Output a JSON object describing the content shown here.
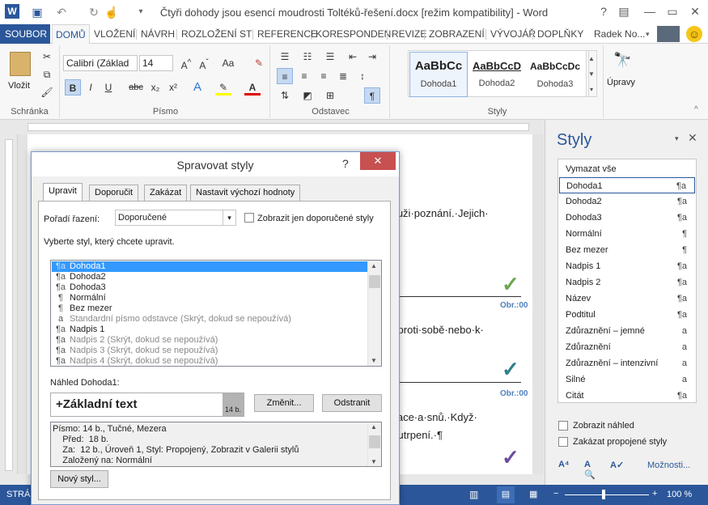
{
  "window": {
    "title": "Čtyři dohody jsou esencí moudrosti Toltéků-řešení.docx [režim kompatibility] - Word",
    "help": "?",
    "minimize": "—",
    "restore": "▭",
    "close": "✕"
  },
  "quick_access": {
    "word_icon": "W",
    "save": "💾",
    "undo": "↶",
    "redo": "↻",
    "touch": "☝",
    "more": "▾"
  },
  "tabs": {
    "file": "SOUBOR",
    "items": [
      "DOMŮ",
      "VLOŽENÍ",
      "NÁVRH",
      "ROZLOŽENÍ ST",
      "REFERENCE",
      "KORESPONDEN",
      "REVIZE",
      "ZOBRAZENÍ",
      "VÝVOJÁŘ",
      "DOPLŇKY"
    ],
    "user": "Radek No...",
    "smiley": "☺"
  },
  "ribbon": {
    "clipboard": {
      "paste": "Vložit",
      "label": "Schránka"
    },
    "font": {
      "name": "Calibri (Základ",
      "size": "14",
      "bold": "B",
      "italic": "I",
      "underline": "U",
      "strike": "abc",
      "sub": "x₂",
      "sup": "x²",
      "grow": "A^",
      "shrink": "Aˇ",
      "case": "Aa",
      "label": "Písmo"
    },
    "paragraph": {
      "label": "Odstavec",
      "pilcrow": "¶"
    },
    "styles": {
      "label": "Styly",
      "items": [
        {
          "preview": "AaBbCc",
          "name": "Dohoda1"
        },
        {
          "preview": "AaBbCcD",
          "name": "Dohoda2"
        },
        {
          "preview": "AaBbCcDc",
          "name": "Dohoda3"
        }
      ]
    },
    "editing": {
      "label": "Úpravy"
    }
  },
  "document": {
    "lines": [
      "muži·poznání.·Jejich·",
      "a·proti·sobě·nebo·k·",
      "tuace·a·snů.·Když·",
      "o·utrpení.·¶"
    ],
    "captions": [
      "Obr.:00",
      "Obr.:00"
    ],
    "checkmark": "✓"
  },
  "status": {
    "page": "STRÁN",
    "zoom": "100 %",
    "minus": "−",
    "plus": "+"
  },
  "styles_pane": {
    "title": "Styly",
    "clear": "Vymazat vše",
    "items": [
      {
        "name": "Dohoda1",
        "sym": "¶a",
        "selected": true
      },
      {
        "name": "Dohoda2",
        "sym": "¶a"
      },
      {
        "name": "Dohoda3",
        "sym": "¶a"
      },
      {
        "name": "Normální",
        "sym": "¶"
      },
      {
        "name": "Bez mezer",
        "sym": "¶"
      },
      {
        "name": "Nadpis 1",
        "sym": "¶a"
      },
      {
        "name": "Nadpis 2",
        "sym": "¶a"
      },
      {
        "name": "Název",
        "sym": "¶a"
      },
      {
        "name": "Podtitul",
        "sym": "¶a"
      },
      {
        "name": "Zdůraznění – jemné",
        "sym": "a"
      },
      {
        "name": "Zdůraznění",
        "sym": "a"
      },
      {
        "name": "Zdůraznění – intenzivní",
        "sym": "a"
      },
      {
        "name": "Silné",
        "sym": "a"
      },
      {
        "name": "Citát",
        "sym": "¶a"
      }
    ],
    "show_preview": "Zobrazit náhled",
    "disable_linked": "Zakázat propojené styly",
    "options": "Možnosti..."
  },
  "dialog": {
    "title": "Spravovat styly",
    "help": "?",
    "close": "✕",
    "tabs": [
      "Upravit",
      "Doporučit",
      "Zakázat",
      "Nastavit výchozí hodnoty"
    ],
    "sort_label": "Pořadí řazení:",
    "sort_value": "Doporučené",
    "only_recommended": "Zobrazit jen doporučené styly",
    "select_label": "Vyberte styl, který chcete upravit.",
    "list": [
      {
        "sym": "¶a",
        "name": "Dohoda1",
        "state": "sel"
      },
      {
        "sym": "¶a",
        "name": "Dohoda2"
      },
      {
        "sym": "¶a",
        "name": "Dohoda3"
      },
      {
        "sym": "¶",
        "name": "Normální"
      },
      {
        "sym": "¶",
        "name": "Bez mezer"
      },
      {
        "sym": "a",
        "name": "Standardní písmo odstavce  (Skrýt, dokud se nepoužívá)",
        "state": "dis"
      },
      {
        "sym": "¶a",
        "name": "Nadpis 1"
      },
      {
        "sym": "¶a",
        "name": "Nadpis 2  (Skrýt, dokud se nepoužívá)",
        "state": "dis"
      },
      {
        "sym": "¶a",
        "name": "Nadpis 3  (Skrýt, dokud se nepoužívá)",
        "state": "dis"
      },
      {
        "sym": "¶a",
        "name": "Nadpis 4  (Skrýt, dokud se nepoužívá)",
        "state": "dis"
      }
    ],
    "preview_label": "Náhled Dohoda1:",
    "preview_text": "+Základní text",
    "preview_size": "14 b.",
    "modify": "Změnit...",
    "delete": "Odstranit",
    "desc": [
      "Písmo: 14 b., Tučné, Mezera",
      "    Před:  18 b.",
      "    Za:  12 b., Úroveň 1, Styl: Propojený, Zobrazit v Galerii stylů",
      "    Založený na: Normální"
    ],
    "new_style": "Nový styl..."
  }
}
